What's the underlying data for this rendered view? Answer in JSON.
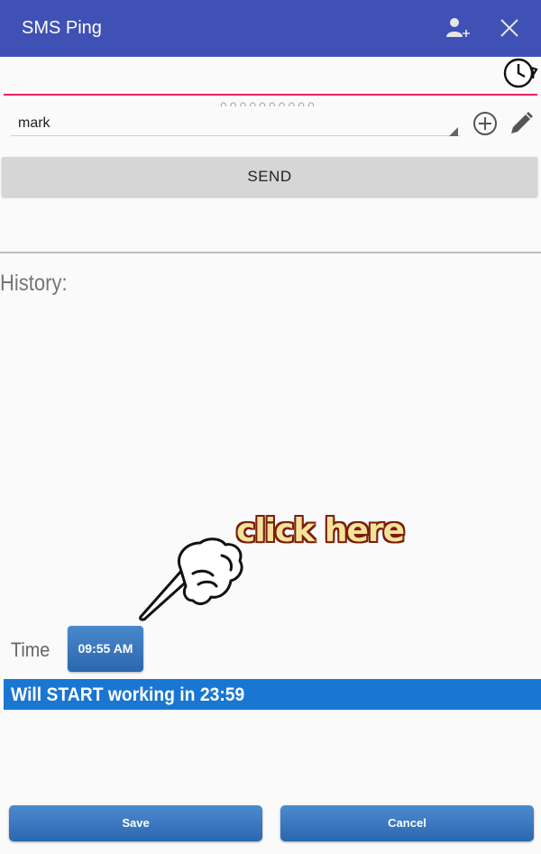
{
  "appbar": {
    "title": "SMS Ping",
    "add_contact_icon": "person-add-icon",
    "close_icon": "close-icon",
    "color": "#3f51b5"
  },
  "phone": {
    "value": "0000000000",
    "history_icon": "clock-history-icon",
    "accent": "#e91e63"
  },
  "contact": {
    "selected": "mark",
    "add_icon": "add-circle-icon",
    "edit_icon": "pencil-icon"
  },
  "send_label": "SEND",
  "history": {
    "label": "History:"
  },
  "annotation": {
    "text": "click here",
    "icon": "pointing-hand-icon"
  },
  "time": {
    "label": "Time",
    "value": "09:55 AM"
  },
  "status": {
    "text": "Will START working in 23:59",
    "color": "#1976d2"
  },
  "buttons": {
    "save": "Save",
    "cancel": "Cancel"
  }
}
